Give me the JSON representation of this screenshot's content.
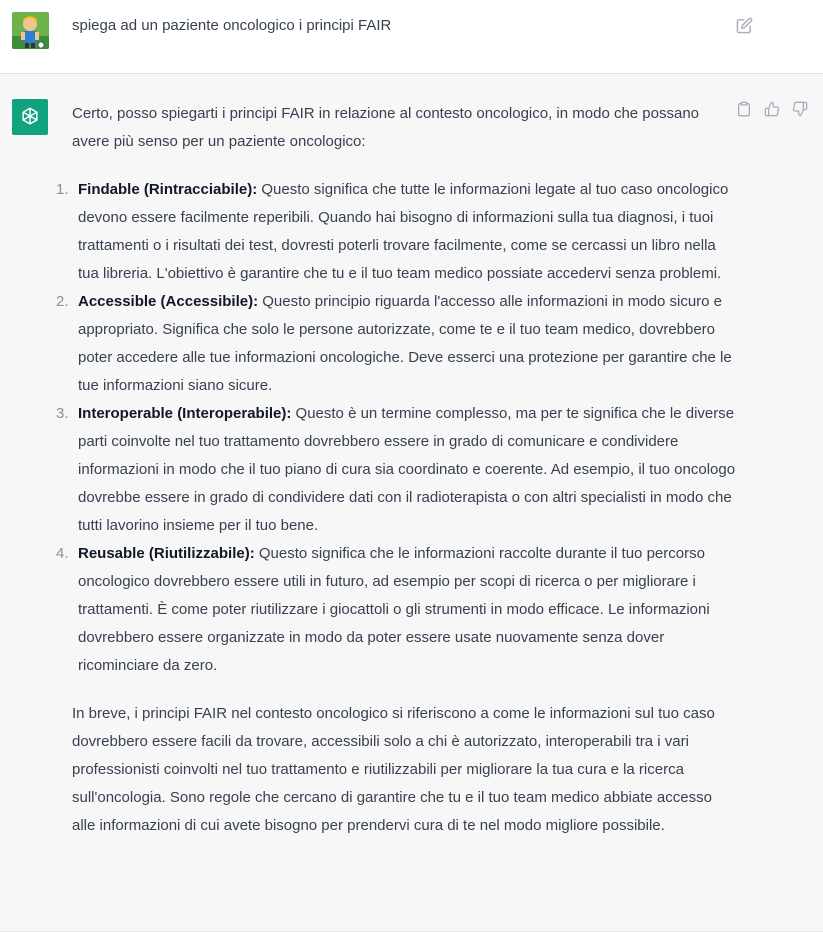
{
  "user_message": {
    "text": "spiega ad un paziente oncologico i principi FAIR"
  },
  "assistant_message": {
    "intro": "Certo, posso spiegarti i principi FAIR in relazione al contesto oncologico, in modo che possano avere più senso per un paziente oncologico:",
    "items": [
      {
        "number": "1.",
        "title": "Findable (Rintracciabile):",
        "body": " Questo significa che tutte le informazioni legate al tuo caso oncologico devono essere facilmente reperibili. Quando hai bisogno di informazioni sulla tua diagnosi, i tuoi trattamenti o i risultati dei test, dovresti poterli trovare facilmente, come se cercassi un libro nella tua libreria. L'obiettivo è garantire che tu e il tuo team medico possiate accedervi senza problemi."
      },
      {
        "number": "2.",
        "title": "Accessible (Accessibile):",
        "body": " Questo principio riguarda l'accesso alle informazioni in modo sicuro e appropriato. Significa che solo le persone autorizzate, come te e il tuo team medico, dovrebbero poter accedere alle tue informazioni oncologiche. Deve esserci una protezione per garantire che le tue informazioni siano sicure."
      },
      {
        "number": "3.",
        "title": "Interoperable (Interoperabile):",
        "body": " Questo è un termine complesso, ma per te significa che le diverse parti coinvolte nel tuo trattamento dovrebbero essere in grado di comunicare e condividere informazioni in modo che il tuo piano di cura sia coordinato e coerente. Ad esempio, il tuo oncologo dovrebbe essere in grado di condividere dati con il radioterapista o con altri specialisti in modo che tutti lavorino insieme per il tuo bene."
      },
      {
        "number": "4.",
        "title": "Reusable (Riutilizzabile):",
        "body": " Questo significa che le informazioni raccolte durante il tuo percorso oncologico dovrebbero essere utili in futuro, ad esempio per scopi di ricerca o per migliorare i trattamenti. È come poter riutilizzare i giocattoli o gli strumenti in modo efficace. Le informazioni dovrebbero essere organizzate in modo da poter essere usate nuovamente senza dover ricominciare da zero."
      }
    ],
    "summary": "In breve, i principi FAIR nel contesto oncologico si riferiscono a come le informazioni sul tuo caso dovrebbero essere facili da trovare, accessibili solo a chi è autorizzato, interoperabili tra i vari professionisti coinvolti nel tuo trattamento e riutilizzabili per migliorare la tua cura e la ricerca sull'oncologia. Sono regole che cercano di garantire che tu e il tuo team medico abbiate accesso alle informazioni di cui avete bisogno per prendervi cura di te nel modo migliore possibile."
  },
  "icons": {
    "user_avatar": "user-avatar-icon",
    "edit": "edit-icon",
    "gpt_logo": "openai-logo-icon",
    "copy": "clipboard-icon",
    "thumbs_up": "thumbs-up-icon",
    "thumbs_down": "thumbs-down-icon"
  },
  "colors": {
    "assistant_background": "#f7f7f8",
    "gpt_avatar": "#10a37f",
    "text": "#374151"
  }
}
